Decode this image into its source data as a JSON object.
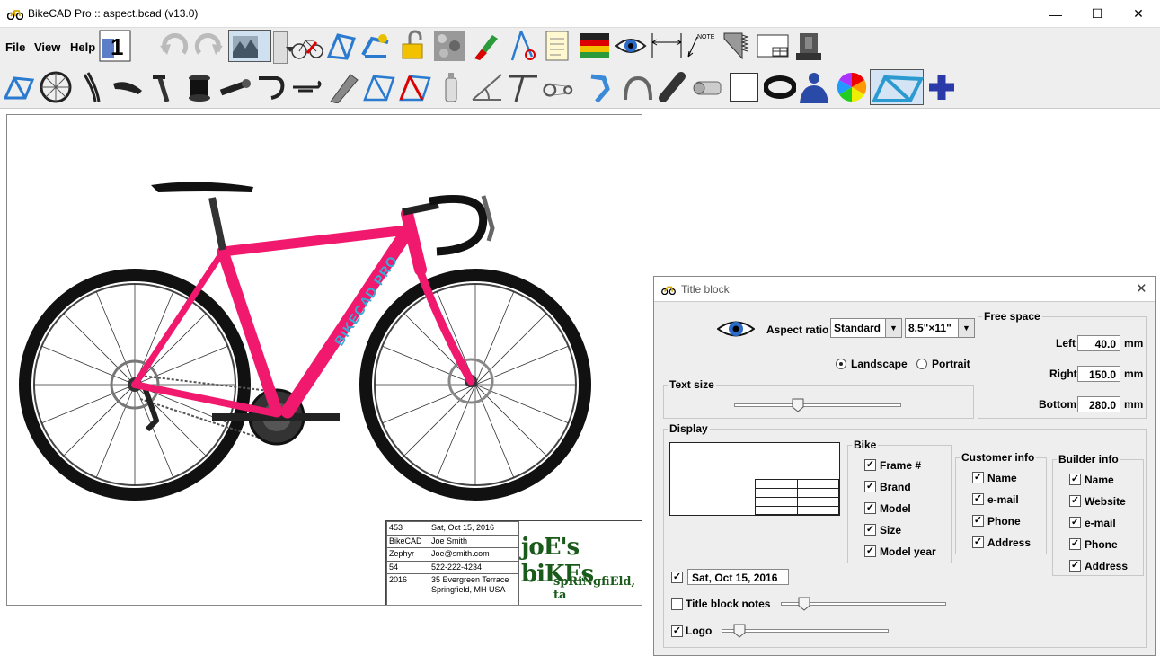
{
  "window": {
    "title": "BikeCAD Pro :: aspect.bcad (v13.0)",
    "minimize": "—",
    "maximize": "☐",
    "close": "✕"
  },
  "menu": {
    "file": "File",
    "view": "View",
    "help": "Help"
  },
  "toolbar_row1": [
    "paper-size-icon",
    "undo-icon",
    "redo-icon",
    "background-icon",
    "dropdown-icon",
    "bike-view-icon",
    "frame-3d-icon",
    "tubes-icon",
    "lock-icon",
    "texture-icon",
    "color-icon",
    "compass-icon",
    "notes-icon",
    "flags-icon",
    "eye-icon",
    "dimension-icon",
    "note-icon",
    "saw-icon",
    "title-block-icon",
    "vise-icon"
  ],
  "toolbar_row2": [
    "frame-icon",
    "wheel-icon",
    "fork-icon",
    "saddle-icon",
    "seatpost-icon",
    "headset-icon",
    "stem-icon",
    "handlebar-icon",
    "aerobar-icon",
    "tube-icon",
    "geometry-icon",
    "frame-red-icon",
    "bottle-icon",
    "angle-icon",
    "seatstay-icon",
    "drivetrain-icon",
    "derailleur-icon",
    "brake-icon",
    "cable-icon",
    "hub-icon",
    "box-icon",
    "tire-icon",
    "rider-icon",
    "color-wheel-icon",
    "frame-blue-icon",
    "plus-icon"
  ],
  "title_block": {
    "rows": [
      [
        "453",
        "Sat, Oct 15, 2016"
      ],
      [
        "BikeCAD",
        "Joe Smith"
      ],
      [
        "Zephyr",
        "Joe@smith.com"
      ],
      [
        "54",
        "522-222-4234"
      ],
      [
        "2016",
        "35 Evergreen Terrace Springfield, MH USA"
      ]
    ],
    "logo_line1": "joE's biKEs",
    "logo_line2": "spRiNgfiEld, ta"
  },
  "bike_decal": "BIKECAD PRO",
  "dialog": {
    "title": "Title block",
    "aspect_ratio_label": "Aspect ratio",
    "aspect_ratio_value": "Standard",
    "paper_value": "8.5\"×11\"",
    "landscape": "Landscape",
    "portrait": "Portrait",
    "free_space": "Free space",
    "left_label": "Left",
    "left_value": "40.0",
    "right_label": "Right",
    "right_value": "150.0",
    "bottom_label": "Bottom",
    "bottom_value": "280.0",
    "unit": "mm",
    "text_size": "Text size",
    "display": "Display",
    "bike_group": "Bike",
    "bike_items": [
      "Frame #",
      "Brand",
      "Model",
      "Size",
      "Model year"
    ],
    "customer_group": "Customer info",
    "customer_items": [
      "Name",
      "e-mail",
      "Phone",
      "Address"
    ],
    "builder_group": "Builder info",
    "builder_items": [
      "Name",
      "Website",
      "e-mail",
      "Phone",
      "Address"
    ],
    "date_value": "Sat, Oct 15, 2016",
    "notes_label": "Title block notes",
    "logo_label": "Logo"
  }
}
